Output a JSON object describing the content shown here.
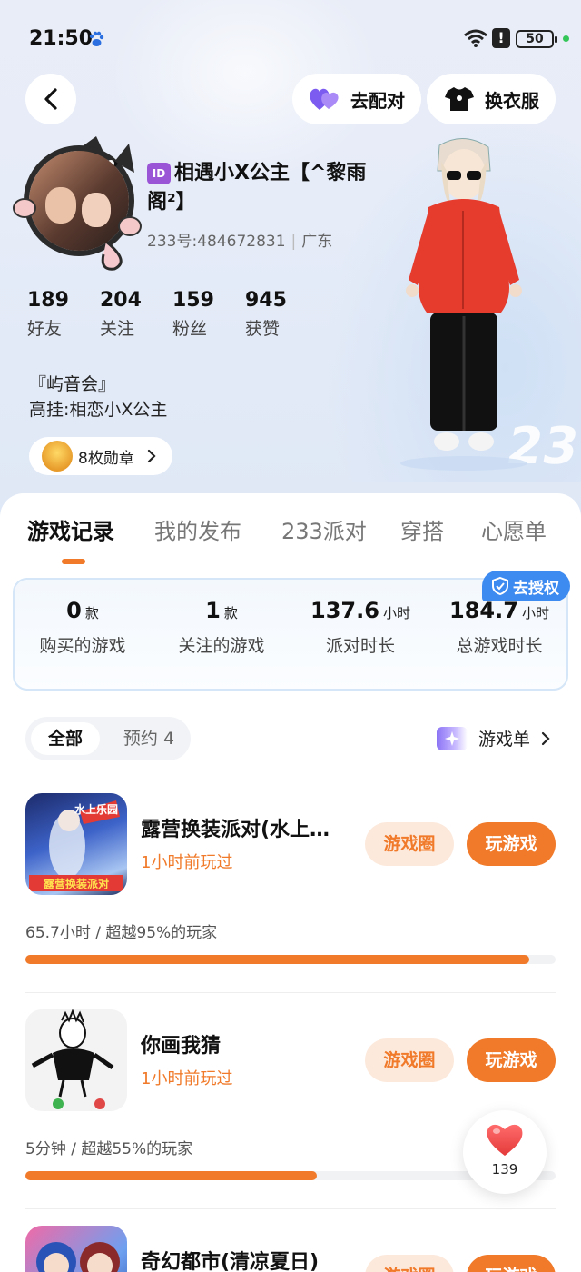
{
  "status_bar": {
    "time": "21:50",
    "battery": "50"
  },
  "header": {
    "match_label": "去配对",
    "wardrobe_label": "换衣服"
  },
  "profile": {
    "name_line1": "相遇小X公主【^黎雨",
    "name_line2": "阁²】",
    "uid": "233号:484672831",
    "location": "广东",
    "stats": [
      {
        "value": "189",
        "label": "好友"
      },
      {
        "value": "204",
        "label": "关注"
      },
      {
        "value": "159",
        "label": "粉丝"
      },
      {
        "value": "945",
        "label": "获赞"
      }
    ],
    "bio_line1": "『屿音会』",
    "bio_line2": "高挂:相恋小X公主",
    "medals": "8枚勋章"
  },
  "tabs": [
    "游戏记录",
    "我的发布",
    "233派对",
    "穿搭",
    "心愿单"
  ],
  "summary": {
    "auth_label": "去授权",
    "items": [
      {
        "value": "0",
        "unit": "款",
        "label": "购买的游戏"
      },
      {
        "value": "1",
        "unit": "款",
        "label": "关注的游戏"
      },
      {
        "value": "137.6",
        "unit": "小时",
        "label": "派对时长"
      },
      {
        "value": "184.7",
        "unit": "小时",
        "label": "总游戏时长"
      }
    ]
  },
  "filter": {
    "all": "全部",
    "reserve": "预约 4"
  },
  "gamelist_link": "游戏单",
  "games": [
    {
      "title": "露营换装派对(水上…",
      "subtitle": "1小时前玩过",
      "stat": "65.7小时 / 超越95%的玩家",
      "progress": 0.95,
      "circle_btn": "游戏圈",
      "play_btn": "玩游戏",
      "icon_text_top": "水上乐园",
      "icon_text_bottom": "露营换装派对"
    },
    {
      "title": "你画我猜",
      "subtitle": "1小时前玩过",
      "stat": "5分钟 / 超越55%的玩家",
      "progress": 0.55,
      "circle_btn": "游戏圈",
      "play_btn": "玩游戏"
    },
    {
      "title": "奇幻都市(清凉夏日)",
      "circle_btn": "游戏圈",
      "play_btn": "玩游戏"
    }
  ],
  "like_count": "139",
  "colors": {
    "accent": "#f07a2a",
    "accent_light": "#fde9dc",
    "blue": "#3d8af0"
  }
}
